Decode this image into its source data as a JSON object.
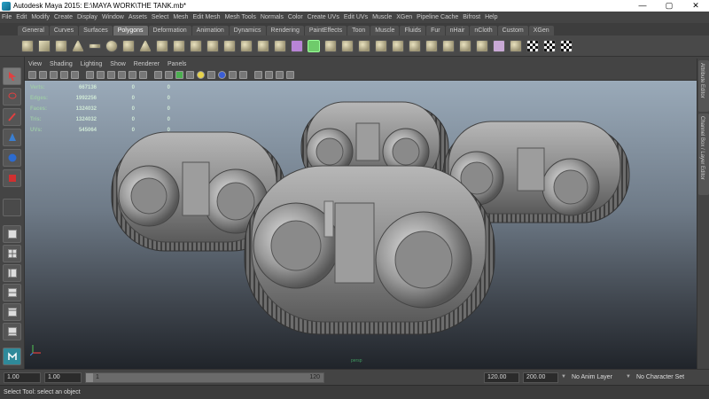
{
  "window": {
    "title": "Autodesk Maya 2015: E:\\MAYA WORK\\THE TANK.mb*",
    "minimize": "—",
    "maximize": "▢",
    "close": "✕"
  },
  "menubar": [
    "File",
    "Edit",
    "Modify",
    "Create",
    "Display",
    "Window",
    "Assets",
    "Select",
    "Mesh",
    "Edit Mesh",
    "Mesh Tools",
    "Normals",
    "Color",
    "Create UVs",
    "Edit UVs",
    "Muscle",
    "XGen",
    "Pipeline Cache",
    "Bifrost",
    "Help"
  ],
  "shelf_tabs": [
    "General",
    "Curves",
    "Surfaces",
    "Polygons",
    "Deformation",
    "Animation",
    "Dynamics",
    "Rendering",
    "PaintEffects",
    "Toon",
    "Muscle",
    "Fluids",
    "Fur",
    "nHair",
    "nCloth",
    "Custom",
    "XGen"
  ],
  "shelf_tabs_active": "Polygons",
  "panel_menu": [
    "View",
    "Shading",
    "Lighting",
    "Show",
    "Renderer",
    "Panels"
  ],
  "hud": {
    "rows": [
      {
        "label": "Verts:",
        "a": "667136",
        "b": "0",
        "c": "0"
      },
      {
        "label": "Edges:",
        "a": "1992256",
        "b": "0",
        "c": "0"
      },
      {
        "label": "Faces:",
        "a": "1324032",
        "b": "0",
        "c": "0"
      },
      {
        "label": "Tris:",
        "a": "1324032",
        "b": "0",
        "c": "0"
      },
      {
        "label": "UVs:",
        "a": "545064",
        "b": "0",
        "c": "0"
      }
    ]
  },
  "camera_label": "persp",
  "right_dock": {
    "attribute_editor": "Attribute Editor",
    "channel_box": "Channel Box / Layer Editor"
  },
  "range": {
    "start": "1.00",
    "playback_start": "1.00",
    "slider_start": "1",
    "slider_end": "120",
    "playback_end": "120.00",
    "end": "200.00",
    "anim_layer": "No Anim Layer",
    "character_set": "No Character Set"
  },
  "help_line": "Select Tool: select an object"
}
